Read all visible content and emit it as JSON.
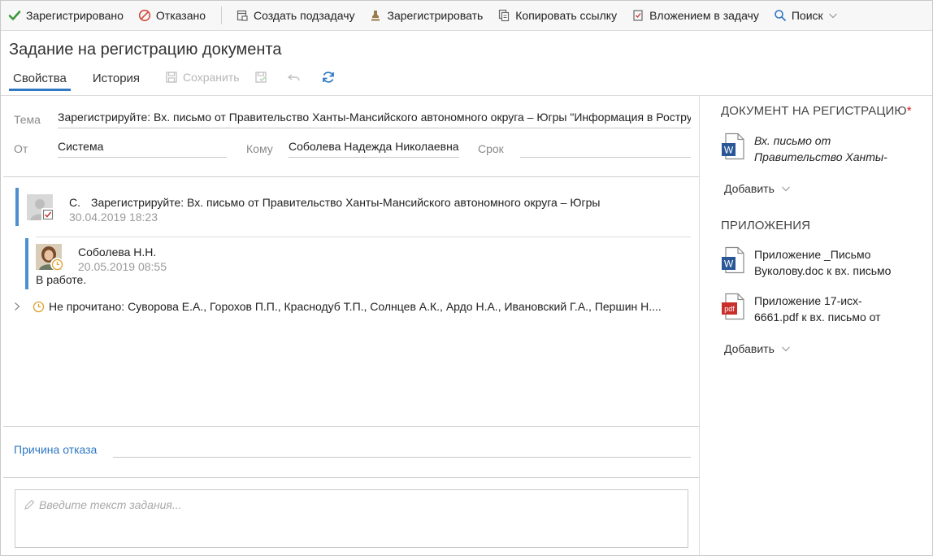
{
  "toolbar": {
    "registered": "Зарегистрировано",
    "refused": "Отказано",
    "create_subtask": "Создать подзадачу",
    "register": "Зарегистрировать",
    "copy_link": "Копировать ссылку",
    "attach_to_task": "Вложением в задачу",
    "search": "Поиск"
  },
  "header": {
    "title": "Задание на регистрацию документа",
    "tabs": [
      {
        "label": "Свойства",
        "active": true
      },
      {
        "label": "История",
        "active": false
      }
    ],
    "save_label": "Сохранить"
  },
  "form": {
    "subject_label": "Тема",
    "subject_value": "Зарегистрируйте: Вх. письмо от Правительство Ханты-Мансийского автономного округа – Югры \"Информация в Ростру",
    "from_label": "От",
    "from_value": "Система",
    "to_label": "Кому",
    "to_value": "Соболева Надежда Николаевна",
    "deadline_label": "Срок",
    "deadline_value": ""
  },
  "thread": {
    "message": {
      "author": "С.",
      "text": "Зарегистрируйте: Вх. письмо от Правительство Ханты-Мансийского автономного округа – Югры",
      "date": "30.04.2019 18:23"
    },
    "reply": {
      "author": "Соболева Н.Н.",
      "date": "20.05.2019 08:55",
      "status": "В работе."
    },
    "unread": "Не прочитано: Суворова Е.А., Горохов П.П., Краснодуб Т.П., Солнцев А.К., Ардо Н.А., Ивановский Г.А., Першин Н...."
  },
  "refusal": {
    "label": "Причина отказа",
    "value": ""
  },
  "task_text": {
    "placeholder": "Введите текст задания..."
  },
  "right_panel": {
    "doc_heading": "ДОКУМЕНТ НА РЕГИСТРАЦИЮ",
    "required_mark": "*",
    "document": {
      "line1": "Вх. письмо от",
      "line2": "Правительство Ханты-",
      "icon": "word-doc-icon"
    },
    "add_label": "Добавить",
    "attachments_heading": "ПРИЛОЖЕНИЯ",
    "attachments": [
      {
        "line1": "Приложение _Письмо",
        "line2": "Вуколову.doc к вх. письмо",
        "icon": "word-doc-icon"
      },
      {
        "line1": "Приложение 17-исх-",
        "line2": "6661.pdf к вх. письмо от",
        "icon": "pdf-icon"
      }
    ],
    "add_label2": "Добавить"
  },
  "colors": {
    "accent": "#2f78c4",
    "thread_bar": "#4e8fd0",
    "required": "#d42020",
    "check_green": "#3a9a3a",
    "refuse_red": "#d24a3a"
  }
}
